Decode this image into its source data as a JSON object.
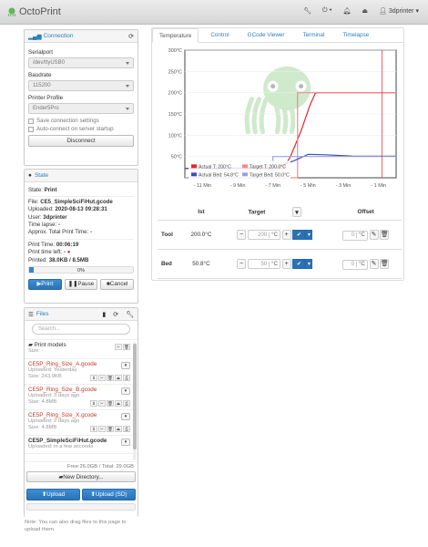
{
  "navbar": {
    "brand": "OctoPrint",
    "user": "3dprinter"
  },
  "connection": {
    "title": "Connection",
    "serialport_label": "Serialport",
    "serialport_value": "/dev/ttyUSB0",
    "baudrate_label": "Baudrate",
    "baudrate_value": "115200",
    "profile_label": "Printer Profile",
    "profile_value": "Ender5Pro",
    "save_label": "Save connection settings",
    "auto_label": "Auto-connect on server startup",
    "disconnect_label": "Disconnect"
  },
  "state": {
    "title": "State",
    "state_label": "State:",
    "state_value": "Print",
    "file_label": "File:",
    "file_value": "CE5_SimpleSciFiHut.gcode",
    "uploaded_label": "Uploaded:",
    "uploaded_value": "2020-08-13 09:28:31",
    "user_label": "User:",
    "user_value": "3dprinter",
    "timelapse_label": "Time lapse:",
    "timelapse_value": "-",
    "approx_label": "Approx. Total Print Time:",
    "approx_value": "-",
    "printtime_label": "Print Time:",
    "printtime_value": "00:06:19",
    "timeleft_label": "Print time left:",
    "timeleft_value": "-",
    "printed_label": "Printed:",
    "printed_value": "38.0KB / 8.5MB",
    "progress_text": "0%",
    "progress": 0.04,
    "print_label": "Print",
    "pause_label": "Pause",
    "cancel_label": "Cancel"
  },
  "files": {
    "title": "Files",
    "search_placeholder": "Search...",
    "folder_name": "Print models",
    "folder_size": "Size: -",
    "items": [
      {
        "name": "CE5P_Ring_Size_A.gcode",
        "uploaded": "Uploaded: Yesterday",
        "size": "Size: 243.9KB"
      },
      {
        "name": "CE5P_Ring_Size_B.gcode",
        "uploaded": "Uploaded: 3 days ago",
        "size": "Size: 4.8MB"
      },
      {
        "name": "CE5P_Ring_Size_X.gcode",
        "uploaded": "Uploaded: 2 days ago",
        "size": "Size: 4.8MB"
      },
      {
        "name": "CE5P_SimpleSciFiHut.gcode",
        "uploaded": "Uploaded: in a few seconds",
        "size": ""
      }
    ],
    "free_text": "Free:26.0GB / Total: 29.0GB",
    "new_dir_label": "New Directory...",
    "upload_label": "Upload",
    "upload_sd_label": "Upload (SD)",
    "note": "Note: You can also drag files to this page to upload them."
  },
  "tabs": [
    "Temperature",
    "Control",
    "GCode Viewer",
    "Terminal",
    "Timelapse"
  ],
  "temp_table": {
    "col_actual": "Ist",
    "col_target": "Target",
    "col_offset": "Offset",
    "tool_label": "Tool",
    "tool_actual": "200.0°C",
    "tool_target": "200",
    "tool_offset": "0",
    "bed_label": "Bed",
    "bed_actual": "50.8°C",
    "bed_target": "50",
    "bed_offset": "0",
    "unit": "°C"
  },
  "chart_data": {
    "type": "line",
    "y_ticks": [
      "300°C",
      "250°C",
      "200°C",
      "150°C",
      "100°C",
      "50°C"
    ],
    "x_ticks": [
      "- 11 Min",
      "- 9 Min",
      "- 7 Min",
      "- 5 Min",
      "- 3 Min",
      "- 1 Min"
    ],
    "ylim": [
      0,
      300
    ],
    "xlim": [
      -12,
      0
    ],
    "legend": [
      "Actual T: 200°C",
      "Target T: 200.0°C",
      "Actual Bed: 54.8°C",
      "Target Bed: 50.0°C"
    ],
    "series": [
      {
        "name": "Actual T: 200°C",
        "color": "#e8242b",
        "x": [
          -12,
          -6.4,
          -6,
          -5.4,
          -4.9,
          -4.6,
          -4.5,
          0
        ],
        "y": [
          22,
          22,
          50,
          110,
          170,
          198,
          200,
          200
        ]
      },
      {
        "name": "Target T: 200.0°C",
        "color": "#f08a8f",
        "x": [
          -12,
          -5.6,
          -5.6,
          0
        ],
        "y": [
          0,
          0,
          200,
          200
        ]
      },
      {
        "name": "Actual Bed: 54.8°C",
        "color": "#3b4fbd",
        "x": [
          -12,
          -6.8,
          -5.8,
          -5,
          -4,
          -2.5,
          0
        ],
        "y": [
          22,
          24,
          40,
          55,
          54,
          51,
          50.8
        ]
      },
      {
        "name": "Target Bed: 50.0°C",
        "color": "#9aa1dc",
        "x": [
          -12,
          -7,
          -7,
          0
        ],
        "y": [
          0,
          0,
          50,
          50
        ]
      }
    ],
    "vline_x": -0.8
  }
}
